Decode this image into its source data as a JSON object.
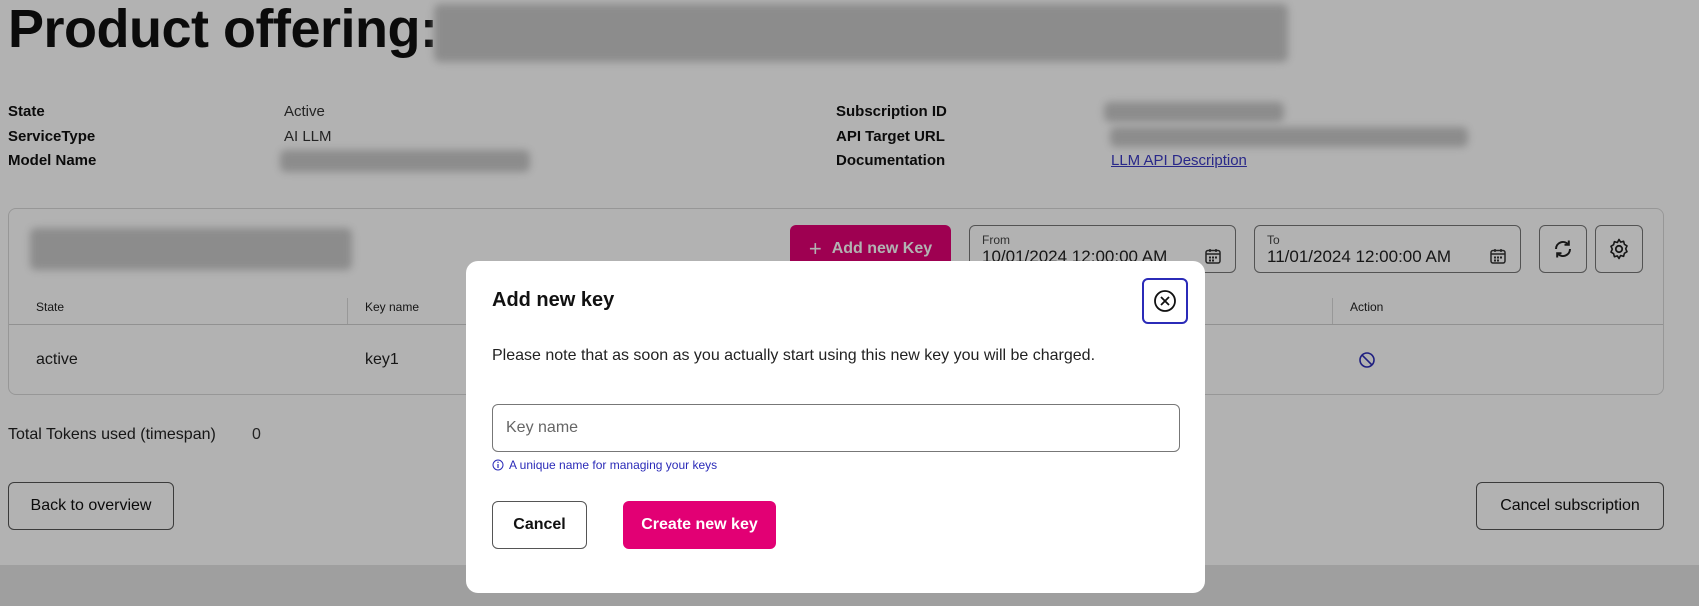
{
  "page": {
    "title": "Product offering:",
    "details_left": [
      {
        "label": "State",
        "value": "Active"
      },
      {
        "label": "ServiceType",
        "value": "AI LLM"
      },
      {
        "label": "Model Name",
        "value": ""
      }
    ],
    "details_right": [
      {
        "label": "Subscription ID",
        "value": ""
      },
      {
        "label": "API Target URL",
        "value": ""
      },
      {
        "label": "Documentation",
        "value": "LLM API Description"
      }
    ]
  },
  "keys_panel": {
    "add_key_label": "Add new Key",
    "from_label": "From",
    "from_value": "10/01/2024 12:00:00 AM",
    "to_label": "To",
    "to_value": "11/01/2024 12:00:00 AM",
    "refresh_icon": "refresh-icon",
    "settings_icon": "gear-icon",
    "table": {
      "headers": [
        "State",
        "Key name",
        "Action"
      ],
      "rows": [
        {
          "state": "active",
          "key_name": "key1",
          "action_icon": "block-icon"
        }
      ]
    }
  },
  "totals": {
    "label": "Total Tokens used (timespan)",
    "value": "0"
  },
  "actions": {
    "back": "Back to overview",
    "cancel_subscription": "Cancel subscription"
  },
  "modal": {
    "title": "Add new key",
    "note": "Please note that as soon as you actually start using this new key you will be charged.",
    "input_placeholder": "Key name",
    "input_value": "",
    "help_text": "A unique name for managing your keys",
    "cancel_label": "Cancel",
    "create_label": "Create new key"
  },
  "colors": {
    "brand": "#e20074",
    "link": "#3b3ac4",
    "focus": "#2b2bb8"
  }
}
